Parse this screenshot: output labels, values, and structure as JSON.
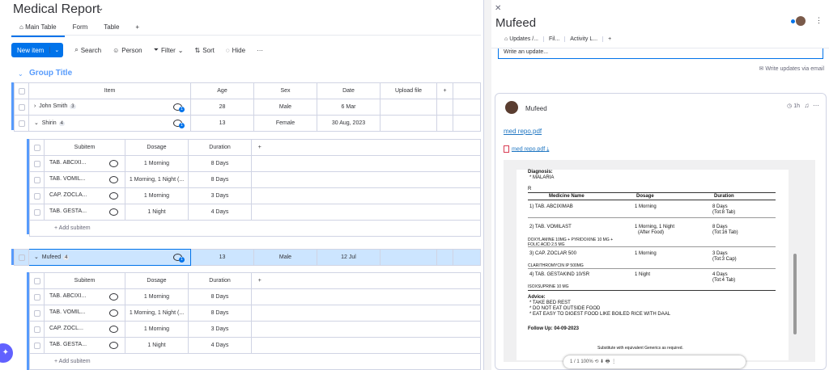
{
  "board": {
    "title": "Medical Report",
    "views": [
      "Main Table",
      "Form",
      "Table",
      "+"
    ],
    "toolbar": {
      "new_item": "New item",
      "search": "Search",
      "person": "Person",
      "filter": "Filter",
      "sort": "Sort",
      "hide": "Hide",
      "more": "···"
    },
    "group_title": "Group Title",
    "columns": [
      "Item",
      "Age",
      "Sex",
      "Date",
      "Upload file",
      "+"
    ],
    "subitem_columns": [
      "Subitem",
      "Dosage",
      "Duration",
      "+"
    ],
    "add_subitem": "+ Add subitem",
    "items": [
      {
        "name": "John Smith",
        "badge": "3",
        "updates": "1",
        "age": "28",
        "sex": "Male",
        "date": "6 Mar"
      },
      {
        "name": "Shirin",
        "badge": "4",
        "updates": "1",
        "age": "13",
        "sex": "Female",
        "date": "30 Aug, 2023",
        "subitems": [
          {
            "name": "TAB. ABCIXI...",
            "dosage": "1 Morning",
            "duration": "8 Days"
          },
          {
            "name": "TAB. VOMIL...",
            "dosage": "1 Morning, 1 Night (...",
            "duration": "8 Days"
          },
          {
            "name": "CAP. ZOCLA...",
            "dosage": "1 Morning",
            "duration": "3 Days"
          },
          {
            "name": "TAB. GESTA...",
            "dosage": "1 Night",
            "duration": "4 Days"
          }
        ]
      },
      {
        "name": "Mufeed",
        "badge": "4",
        "updates": "1",
        "age": "13",
        "sex": "Male",
        "date": "12 Jul",
        "subitems": [
          {
            "name": "TAB. ABCIXI...",
            "dosage": "1 Morning",
            "duration": "8 Days"
          },
          {
            "name": "TAB. VOMIL...",
            "dosage": "1 Morning, 1 Night (...",
            "duration": "8 Days"
          },
          {
            "name": "CAP. ZOCL...",
            "dosage": "1 Morning",
            "duration": "3 Days"
          },
          {
            "name": "TAB. GESTA...",
            "dosage": "1 Night",
            "duration": "4 Days"
          }
        ]
      }
    ]
  },
  "panel": {
    "title": "Mufeed",
    "tabs": [
      "Updates /...",
      "Fil...",
      "Activity L...",
      "+"
    ],
    "write_placeholder": "Write an update...",
    "write_via_email": "Write updates via email",
    "post": {
      "author": "Mufeed",
      "time": "1h",
      "link": "med repo.pdf",
      "file": "med repo.pdf"
    },
    "report": {
      "diagnosis_label": "Diagnosis:",
      "diagnosis": "* MALARIA",
      "rx": "R",
      "headers": [
        "Medicine Name",
        "Dosage",
        "Duration"
      ],
      "rows": [
        {
          "name": "1) TAB. ABCIXIMAB",
          "dosage": "1 Morning",
          "duration": "8 Days",
          "total": "(Tot:8 Tab)",
          "note": ""
        },
        {
          "name": "2) TAB. VOMILAST",
          "dosage": "1 Morning, 1 Night",
          "dosage2": "(After Food)",
          "duration": "8 Days",
          "total": "(Tot:16 Tab)",
          "note": "DOXYLAMINE 10MG + PYRIDOXINE 10 MG + FOLIC ACID 2.5 MG"
        },
        {
          "name": "3) CAP. ZOCLAR 500",
          "dosage": "1 Morning",
          "duration": "3 Days",
          "total": "(Tot:3 Cap)",
          "note": "CLARITHROMYCIN IP 500MG"
        },
        {
          "name": "4) TAB. GESTAKIND 10/SR",
          "dosage": "1 Night",
          "duration": "4 Days",
          "total": "(Tot:4 Tab)",
          "note": "ISOXSUPRINE 10 MG"
        }
      ],
      "advice_label": "Advice:",
      "advice": [
        "* TAKE BED REST",
        "* DO NOT EAT OUTSIDE FOOD",
        "* EAT EASY TO DIGEST FOOD LIKE BOILED RICE WITH DAAL"
      ],
      "follow_up": "Follow Up: 04-09-2023",
      "footer": "Substitute with equivalent Generics as required."
    },
    "viewer_bar": "1 / 1   100%   ⟲   ⬇   🖶   ⋮"
  }
}
